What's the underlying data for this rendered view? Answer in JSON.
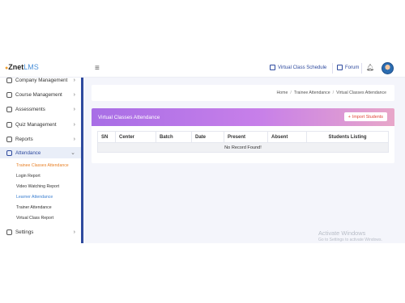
{
  "header": {
    "logo_prefix": "Znet",
    "logo_suffix": "LMS",
    "menu_icon": "hamburger-icon",
    "virtual_class_schedule": "Virtual Class Schedule",
    "forum": "Forum",
    "notification_icon": "bell-icon"
  },
  "sidebar": {
    "items": [
      {
        "label": "Company Management",
        "icon": "building-icon"
      },
      {
        "label": "Course Management",
        "icon": "book-icon"
      },
      {
        "label": "Assessments",
        "icon": "clipboard-icon"
      },
      {
        "label": "Quiz Management",
        "icon": "quiz-icon"
      },
      {
        "label": "Reports",
        "icon": "chart-icon"
      },
      {
        "label": "Attendance",
        "icon": "person-icon"
      },
      {
        "label": "Settings",
        "icon": "gear-icon"
      }
    ],
    "attendance_sub": [
      "Trainee Classes Attendance",
      "Login Report",
      "Video Watching Report",
      "Learner Attendance",
      "Trainer Attendance",
      "Virtual Class Report"
    ]
  },
  "breadcrumb": {
    "home": "Home",
    "trainee": "Trainee Attendance",
    "current": "Virtual Classes Attendance"
  },
  "card": {
    "title": "Virtual Classes Attendance",
    "import_label": "Import Students",
    "columns": [
      "SN",
      "Center",
      "Batch",
      "Date",
      "Present",
      "Absent",
      "Students Listing"
    ],
    "empty_message": "No Record Found!"
  },
  "watermark": {
    "line1": "Activate Windows",
    "line2": "Go to Settings to activate Windows."
  },
  "colors": {
    "accent": "#2e4a9e",
    "header_gradient_start": "#a86ee6",
    "header_gradient_end": "#e8a7c9",
    "active_sub": "#e8822a"
  }
}
